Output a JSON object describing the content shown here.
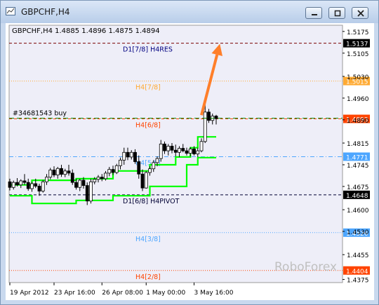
{
  "window": {
    "title": "GBPCHF,H4",
    "window_icon": "chart-window-icon",
    "buttons": [
      {
        "name": "minimize-button",
        "icon": "minimize-icon"
      },
      {
        "name": "restore-button",
        "icon": "restore-icon"
      },
      {
        "name": "close-button",
        "icon": "close-icon"
      }
    ]
  },
  "header": {
    "text": "GBPCHF,H4  1.4885 1.4896 1.4875 1.4894"
  },
  "order_label": "#34681543 buy",
  "watermark": "RoboForex",
  "colors": {
    "background": "#ffffff",
    "plot_background": "#eeeef8",
    "frame": "#c9d9ee",
    "candles": "#000000",
    "envelope": "#00ff00",
    "arrow": "#ff7f2a",
    "res_line": "#7a0000",
    "h4_78": "#ffaa33",
    "h4_68": "#ff4400",
    "h4_58": "#4da6ff",
    "pivot": "#000033",
    "h4_38": "#4da6ff",
    "h4_28": "#ff4400",
    "order_line": "#008000"
  },
  "chart_data": {
    "type": "candlestick",
    "symbol": "GBPCHF",
    "timeframe": "H4",
    "ylim": [
      1.4365,
      1.5195
    ],
    "y_ticks": [
      "1.5175",
      "1.5105",
      "1.5030",
      "1.4960",
      "1.4890",
      "1.4815",
      "1.4745",
      "1.4675",
      "1.4600",
      "1.4530",
      "1.4455",
      "1.4375"
    ],
    "x_ticks": [
      "19 Apr 2012",
      "23 Apr 16:00",
      "26 Apr 08:00",
      "1 May 00:00",
      "3 May 16:00"
    ],
    "levels": [
      {
        "label": "D1[7/8] H4RES",
        "price": 1.5137,
        "price_label": "1.5137",
        "style": "dash",
        "color_key": "res_line",
        "label_color": "#000080",
        "badge_bg": "#000000"
      },
      {
        "label": "H4[7/8]",
        "price": 1.5015,
        "price_label": "1.5015",
        "style": "dot",
        "color_key": "h4_78",
        "label_color": "#ffaa33",
        "badge_bg": "#ffaa33"
      },
      {
        "label": "H4[6/8]",
        "price": 1.4893,
        "price_label": "1.4893",
        "style": "dash",
        "color_key": "h4_68",
        "label_color": "#ff4400",
        "badge_bg": "#ff4400"
      },
      {
        "label": "H4[5/8]",
        "price": 1.4771,
        "price_label": "1.4771",
        "style": "dashdot",
        "color_key": "h4_58",
        "label_color": "#4da6ff",
        "badge_bg": "#4da6ff"
      },
      {
        "label": "D1[6/8] H4PIVOT",
        "price": 1.4648,
        "price_label": "1.4648",
        "style": "dash",
        "color_key": "pivot",
        "label_color": "#000033",
        "badge_bg": "#000000"
      },
      {
        "label": "H4[3/8]",
        "price": 1.4526,
        "price_label": "1.4526",
        "style": "dot",
        "color_key": "h4_38",
        "label_color": "#4da6ff",
        "badge_bg": "#4da6ff"
      },
      {
        "label": "H4[2/8]",
        "price": 1.4404,
        "price_label": "1.4404",
        "style": "dot",
        "color_key": "h4_28",
        "label_color": "#ff4400",
        "badge_bg": "#ff4400"
      }
    ],
    "order": {
      "label": "#34681543 buy",
      "price": 1.4895
    },
    "candles": [
      [
        1.469,
        1.47,
        1.4662,
        1.4672
      ],
      [
        1.4672,
        1.4694,
        1.4665,
        1.4688
      ],
      [
        1.4688,
        1.4702,
        1.4675,
        1.468
      ],
      [
        1.468,
        1.4698,
        1.467,
        1.4693
      ],
      [
        1.4693,
        1.4715,
        1.468,
        1.4688
      ],
      [
        1.4688,
        1.47,
        1.4661,
        1.4668
      ],
      [
        1.4668,
        1.469,
        1.4658,
        1.4684
      ],
      [
        1.4684,
        1.47,
        1.467,
        1.4676
      ],
      [
        1.4676,
        1.4684,
        1.4645,
        1.466
      ],
      [
        1.466,
        1.4696,
        1.4655,
        1.469
      ],
      [
        1.469,
        1.4715,
        1.468,
        1.4705
      ],
      [
        1.4705,
        1.4735,
        1.4698,
        1.4728
      ],
      [
        1.4728,
        1.474,
        1.4705,
        1.4712
      ],
      [
        1.4712,
        1.4738,
        1.47,
        1.4733
      ],
      [
        1.4733,
        1.4745,
        1.4706,
        1.4714
      ],
      [
        1.4714,
        1.4732,
        1.4705,
        1.4725
      ],
      [
        1.4725,
        1.4745,
        1.471,
        1.4718
      ],
      [
        1.4718,
        1.473,
        1.468,
        1.4688
      ],
      [
        1.4688,
        1.47,
        1.4665,
        1.4672
      ],
      [
        1.4672,
        1.47,
        1.466,
        1.4695
      ],
      [
        1.4695,
        1.4705,
        1.4668,
        1.4678
      ],
      [
        1.4678,
        1.4688,
        1.4615,
        1.4628
      ],
      [
        1.4628,
        1.47,
        1.462,
        1.469
      ],
      [
        1.469,
        1.4705,
        1.4682,
        1.4698
      ],
      [
        1.4698,
        1.4712,
        1.4688,
        1.4705
      ],
      [
        1.4705,
        1.4715,
        1.4692,
        1.47
      ],
      [
        1.47,
        1.4725,
        1.4694,
        1.4718
      ],
      [
        1.4718,
        1.4738,
        1.4708,
        1.473
      ],
      [
        1.473,
        1.4742,
        1.4712,
        1.472
      ],
      [
        1.472,
        1.4748,
        1.4715,
        1.4742
      ],
      [
        1.4742,
        1.4768,
        1.473,
        1.476
      ],
      [
        1.476,
        1.48,
        1.4745,
        1.4785
      ],
      [
        1.4785,
        1.48,
        1.476,
        1.477
      ],
      [
        1.477,
        1.4792,
        1.4762,
        1.4785
      ],
      [
        1.4785,
        1.4795,
        1.4748,
        1.4755
      ],
      [
        1.4755,
        1.4775,
        1.47,
        1.4715
      ],
      [
        1.4715,
        1.473,
        1.466,
        1.467
      ],
      [
        1.467,
        1.4725,
        1.4668,
        1.472
      ],
      [
        1.472,
        1.474,
        1.471,
        1.4732
      ],
      [
        1.4732,
        1.476,
        1.4722,
        1.4752
      ],
      [
        1.4752,
        1.4772,
        1.474,
        1.4765
      ],
      [
        1.4765,
        1.4825,
        1.4755,
        1.4812
      ],
      [
        1.4812,
        1.482,
        1.478,
        1.479
      ],
      [
        1.479,
        1.4812,
        1.4775,
        1.4805
      ],
      [
        1.4805,
        1.4815,
        1.4782,
        1.4792
      ],
      [
        1.4792,
        1.481,
        1.4772,
        1.4785
      ],
      [
        1.4785,
        1.4805,
        1.477,
        1.4798
      ],
      [
        1.4798,
        1.4812,
        1.4785,
        1.479
      ],
      [
        1.479,
        1.48,
        1.4775,
        1.4782
      ],
      [
        1.4782,
        1.4802,
        1.4772,
        1.4796
      ],
      [
        1.4796,
        1.4805,
        1.4775,
        1.478
      ],
      [
        1.478,
        1.48,
        1.477,
        1.479
      ],
      [
        1.479,
        1.483,
        1.4785,
        1.482
      ],
      [
        1.482,
        1.4945,
        1.4815,
        1.4915
      ],
      [
        1.4915,
        1.4925,
        1.488,
        1.4888
      ],
      [
        1.4888,
        1.491,
        1.4875,
        1.4902
      ],
      [
        1.4902,
        1.4906,
        1.4875,
        1.4894
      ]
    ],
    "envelope_lower": [
      [
        0,
        1.4645
      ],
      [
        6,
        1.4645
      ],
      [
        6,
        1.462
      ],
      [
        18,
        1.462
      ],
      [
        18,
        1.463
      ],
      [
        28,
        1.463
      ],
      [
        28,
        1.4645
      ],
      [
        38,
        1.4645
      ],
      [
        38,
        1.4675
      ],
      [
        48,
        1.4675
      ],
      [
        48,
        1.4745
      ],
      [
        51,
        1.4745
      ],
      [
        51,
        1.4768
      ],
      [
        56,
        1.4768
      ]
    ],
    "envelope_upper": [
      [
        0,
        1.468
      ],
      [
        6,
        1.468
      ],
      [
        6,
        1.4695
      ],
      [
        18,
        1.4695
      ],
      [
        18,
        1.47
      ],
      [
        28,
        1.47
      ],
      [
        28,
        1.4725
      ],
      [
        38,
        1.4725
      ],
      [
        38,
        1.4745
      ],
      [
        45,
        1.4745
      ],
      [
        45,
        1.477
      ],
      [
        49,
        1.477
      ],
      [
        49,
        1.48
      ],
      [
        51,
        1.48
      ],
      [
        51,
        1.4835
      ],
      [
        56,
        1.4835
      ]
    ],
    "forecast_arrow": {
      "from": [
        52,
        1.4905
      ],
      "to": [
        57,
        1.5135
      ]
    }
  }
}
